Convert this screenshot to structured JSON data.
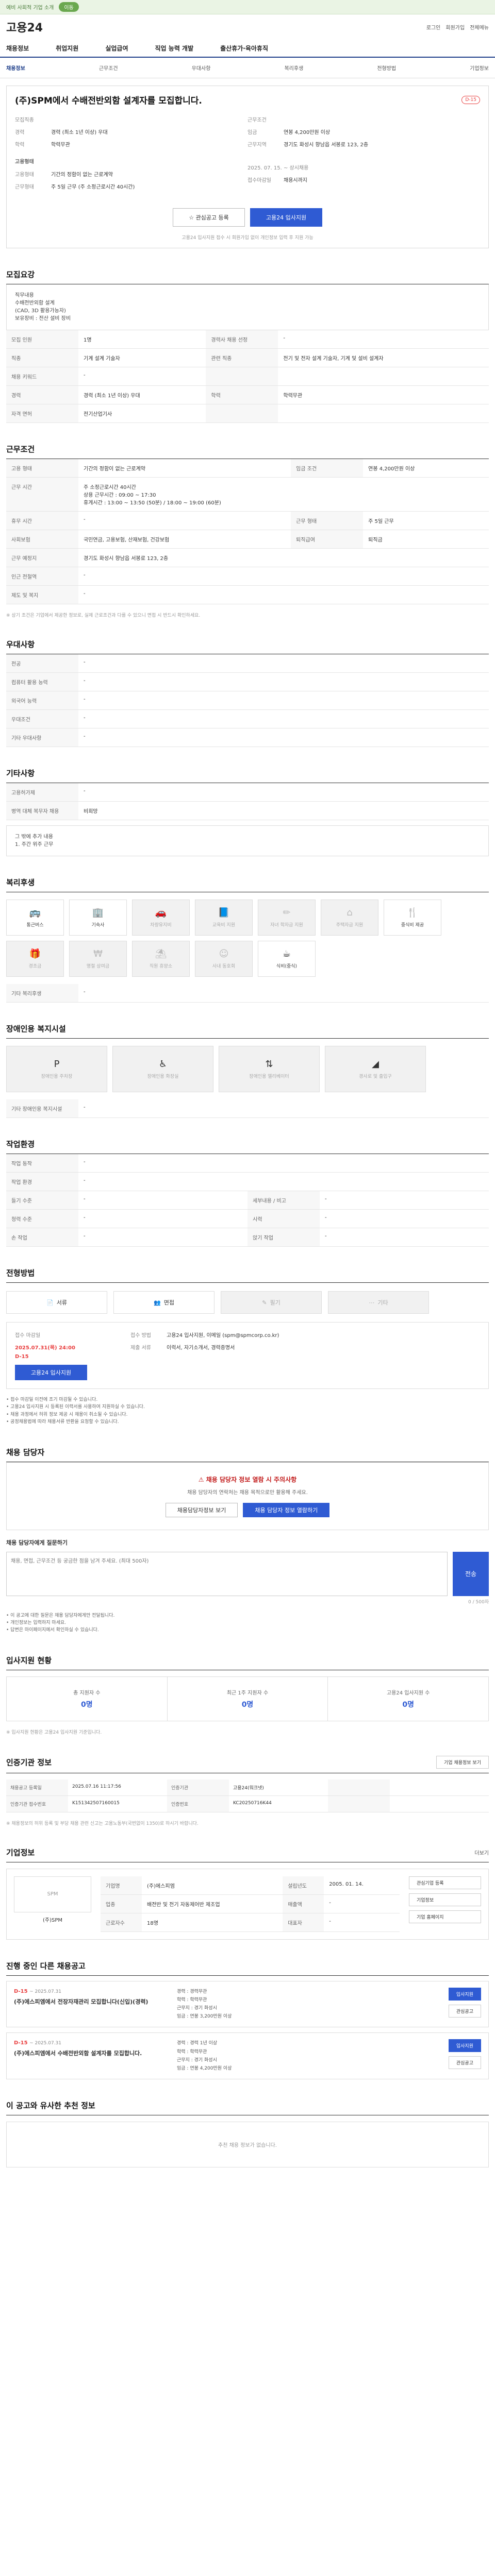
{
  "topbar": {
    "notice": "예비 사회적 기업 소개",
    "pill": "이동"
  },
  "logobar": {
    "logo": "고용24",
    "util": [
      "로그인",
      "회원가입",
      "전체메뉴"
    ]
  },
  "gnb": [
    "채용정보",
    "취업지원",
    "실업급여",
    "직업 능력 개발",
    "출산휴가·육아휴직"
  ],
  "tabs": {
    "items": [
      "채용정보",
      "근무조건",
      "우대사항",
      "복리후생",
      "전형방법"
    ],
    "right": "기업정보"
  },
  "job": {
    "title": "(주)SPM에서 수배전반외함 설계자를 모집합니다.",
    "badge": "D-15",
    "left": [
      {
        "k": "모집직종",
        "v": ""
      },
      {
        "k": "경력",
        "v": "경력 (최소 1년 이상) 우대"
      },
      {
        "k": "학력",
        "v": "학력무관"
      }
    ],
    "right": [
      {
        "k": "근무조건",
        "v": ""
      },
      {
        "k": "임금",
        "v": "연봉 4,200만원 이상"
      },
      {
        "k": "근무지역",
        "v": "경기도 화성시 향남읍 서봉로 123, 2층"
      }
    ],
    "cond_title": "고용형태",
    "cond": [
      {
        "k": "고용형태",
        "v": "기간의 정함이 없는 근로계약"
      },
      {
        "k": "근무형태",
        "v": "주 5일 근무 (주 소정근로시간 40시간)"
      }
    ],
    "extra": [
      {
        "k": "",
        "v": "2025. 07. 15. ~ 상시채용"
      },
      {
        "k": "",
        "v": "접수마감일"
      },
      {
        "k": "",
        "v": "채용시까지"
      }
    ]
  },
  "buttons": {
    "scrap": "관심공고 등록",
    "apply": "고용24 입사지원",
    "note": "고용24 입사지원 접수 시 회원가입 없이 개인정보 입력 후 지원 가능"
  },
  "sec_recruit": {
    "title": "모집요강",
    "summary_lines": [
      "직무내용",
      "수배전반외함 설계",
      "(CAD, 3D 활용가능자)",
      "보유장비 : 전산 설비 장비"
    ],
    "rows": [
      [
        "모집 인원",
        "1명",
        "경력사 채용 선정",
        "-"
      ],
      [
        "직종",
        "기계 설계 기술자",
        "관련 직종",
        "전기 및 전자 설계 기술자, 기계 및 설비 설계자"
      ],
      [
        "채용 키워드",
        "-",
        "",
        ""
      ],
      [
        "경력",
        "경력 (최소 1년 이상) 우대",
        "학력",
        "학력무관"
      ],
      [
        "자격 면허",
        "전기산업기사",
        "",
        ""
      ]
    ]
  },
  "sec_cond": {
    "title": "근무조건",
    "rows": [
      [
        "고용 형태",
        "기간의 정함이 없는 근로계약",
        "임금 조건",
        "연봉 4,200만원 이상"
      ],
      [
        "근무 시간",
        "주 소정근로시간 40시간",
        "",
        ""
      ],
      [
        "",
        "상용 근무시간 : 09:00 ~ 17:30",
        "",
        ""
      ],
      [
        "",
        "휴게시간 : 13:00 ~ 13:50 (50분) / 18:00 ~ 19:00 (60분)",
        "",
        ""
      ],
      [
        "휴무 시간",
        "-",
        "근무 형태",
        "주 5일 근무"
      ],
      [
        "사회보험",
        "국민연금, 고용보험, 산재보험, 건강보험",
        "퇴직급여",
        "퇴직금"
      ],
      [
        "근무 예정지",
        "경기도 화성시 향남읍 서봉로 123, 2층",
        "",
        ""
      ],
      [
        "인근 전철역",
        "-",
        "",
        ""
      ],
      [
        "제도 및 복지",
        "-",
        "",
        ""
      ]
    ],
    "footnote": "※ 상기 조건은 기업에서 제공한 정보로, 실제 근로조건과 다를 수 있으니 면접 시 반드시 확인하세요."
  },
  "sec_pref": {
    "title": "우대사항",
    "rows": [
      [
        "전공",
        "-"
      ],
      [
        "컴퓨터 활용 능력",
        "-"
      ],
      [
        "외국어 능력",
        "-"
      ],
      [
        "우대조건",
        "-"
      ],
      [
        "기타 우대사항",
        "-"
      ]
    ]
  },
  "sec_etc": {
    "title": "기타사항",
    "rows": [
      [
        "고용허가제",
        "-"
      ],
      [
        "병역 대체 복무자 채용",
        "비희망"
      ]
    ],
    "extra": "그 밖에 추가 내용",
    "extra_v": "1. 주간 위주 근무"
  },
  "sec_welfare": {
    "title": "복리후생",
    "icons": [
      {
        "name": "통근버스",
        "icon": "bus-icon",
        "dim": false
      },
      {
        "name": "기숙사",
        "icon": "dorm-icon",
        "dim": false
      },
      {
        "name": "차량유지비",
        "icon": "car-icon",
        "dim": true
      },
      {
        "name": "교육비 지원",
        "icon": "edu-icon",
        "dim": true
      },
      {
        "name": "자녀 학자금 지원",
        "icon": "child-icon",
        "dim": true
      },
      {
        "name": "주택자금 지원",
        "icon": "house-icon",
        "dim": true
      },
      {
        "name": "중식비 제공",
        "icon": "meal-icon",
        "dim": false
      },
      {
        "name": "경조금",
        "icon": "gift-icon",
        "dim": true
      },
      {
        "name": "명절 상여금",
        "icon": "bonus-icon",
        "dim": true
      },
      {
        "name": "직원 휴양소",
        "icon": "rest-icon",
        "dim": true
      },
      {
        "name": "사내 동호회",
        "icon": "club-icon",
        "dim": true
      },
      {
        "name": "식비(중식)",
        "icon": "cup-icon",
        "dim": false
      }
    ],
    "extra_k": "기타 복리후생",
    "extra_v": "-"
  },
  "sec_disabled": {
    "title": "장애인용 복지시설",
    "items": [
      "장애인용 주차장",
      "장애인용 화장실",
      "장애인용 엘리베이터",
      "경사로 및 출입구"
    ],
    "extra_k": "기타 장애인용 복지시설",
    "extra_v": "-"
  },
  "sec_env": {
    "title": "작업환경",
    "rows": [
      [
        "작업 동작",
        "-",
        "",
        ""
      ],
      [
        "작업 환경",
        "-",
        "",
        ""
      ],
      [
        "들기 수준",
        "-",
        "세부내용 / 비고",
        "-"
      ],
      [
        "청력 수준",
        "-",
        "시력",
        "-"
      ],
      [
        "손 작업",
        "-",
        "앉기 작업",
        "-"
      ]
    ]
  },
  "sec_method": {
    "title": "전형방법",
    "methods": [
      {
        "label": "서류",
        "dim": false,
        "icon": "doc-icon"
      },
      {
        "label": "면접",
        "dim": false,
        "icon": "interview-icon"
      },
      {
        "label": "필기",
        "dim": true,
        "icon": "pen-icon"
      },
      {
        "label": "기타",
        "dim": true,
        "icon": "etc-icon"
      }
    ],
    "left_k": "접수 마감일",
    "left_v": "2025.07.31(목) 24:00",
    "dday": "D-15",
    "apply_online": "고용24 입사지원",
    "right_k": "접수 방법",
    "right_v": "고용24 입사지원, 이메일 (spm@spmcorp.co.kr)",
    "doc_k": "제출 서류",
    "doc_v": "이력서, 자기소개서, 경력증명서",
    "notes": [
      "• 접수 마감일 이전에 조기 마감될 수 있습니다.",
      "• 고용24 입사지원 시 등록된 이력서를 사용하여 지원하실 수 있습니다.",
      "• 채용 과정에서 허위 정보 제공 시 채용이 취소될 수 있습니다.",
      "• 공정채용법에 따라 채용서류 반환을 요청할 수 있습니다."
    ]
  },
  "sec_contact": {
    "title": "채용 담당자",
    "warn": "채용 담당자 정보 열람 시 주의사항",
    "desc": "채용 담당자의 연락처는 채용 목적으로만 활용해 주세요.",
    "btn_a": "채용담당자정보 보기",
    "btn_b": "채용 담당자 정보 열람하기",
    "counsel_label": "채용 담당자에게 질문하기",
    "counsel_placeholder": "채용, 면접, 근무조건 등 궁금한 점을 남겨 주세요. (최대 500자)",
    "send": "전송",
    "count": "0 / 500자",
    "notes": [
      "• 이 공고에 대한 질문은 채용 담당자에게만 전달됩니다.",
      "• 개인정보는 입력하지 마세요.",
      "• 답변은 마이페이지에서 확인하실 수 있습니다."
    ]
  },
  "sec_stats": {
    "title": "입사지원 현황",
    "items": [
      {
        "label": "총 지원자 수",
        "n": "0명"
      },
      {
        "label": "최근 1주 지원자 수",
        "n": "0명"
      },
      {
        "label": "고용24 입사지원 수",
        "n": "0명"
      }
    ],
    "note": "※ 입사지원 현황은 고용24 입사지원 기준입니다."
  },
  "sec_info": {
    "title": "인증기관 정보",
    "btn": "기업 채용정보 보기",
    "rows": [
      [
        "채용공고 등록일",
        "2025.07.16 11:17:56",
        "인증기관",
        "고용24(워크넷)",
        "",
        ""
      ],
      [
        "인증기관 접수번호",
        "K151342507160015",
        "인증번호",
        "KC20250716K44",
        "",
        ""
      ]
    ],
    "note": "※ 채용정보의 허위 등록 및 부당 채용 관련 신고는 고용노동부(국번없이 1350)로 하시기 바랍니다."
  },
  "sec_company": {
    "title": "기업정보",
    "more": "더보기",
    "logo": "SPM",
    "name": "(주)SPM",
    "rows": [
      [
        "기업명",
        "(주)에스피엠",
        "설립년도",
        "2005. 01. 14."
      ],
      [
        "업종",
        "배전반 및 전기 자동제어반 제조업",
        "매출액",
        "-"
      ],
      [
        "근로자수",
        "18명",
        "대표자",
        "-"
      ]
    ],
    "btn_a": "관심기업 등록",
    "btn_b": "기업정보",
    "btn_c": "기업 홈페이지"
  },
  "sec_other": {
    "title": "진행 중인 다른 채용공고",
    "jobs": [
      {
        "dday": "D-15",
        "date": "~ 2025.07.31",
        "title": "(주)에스피엠에서 전장자재관리 모집합니다(신입)(경력)",
        "meta": [
          "경력 : 경력무관",
          "학력 : 학력무관",
          "근무지 : 경기 화성시",
          "임금 : 연봉 3,200만원 이상"
        ],
        "btn": "입사지원",
        "scrap": "관심공고"
      },
      {
        "dday": "D-15",
        "date": "~ 2025.07.31",
        "title": "(주)에스피엠에서 수배전반외함 설계자를 모집합니다.",
        "meta": [
          "경력 : 경력 1년 이상",
          "학력 : 학력무관",
          "근무지 : 경기 화성시",
          "임금 : 연봉 4,200만원 이상"
        ],
        "btn": "입사지원",
        "scrap": "관심공고"
      }
    ]
  },
  "sec_recommend": {
    "title": "이 공고와 유사한 추천 정보",
    "empty": "추천 채용 정보가 없습니다."
  }
}
